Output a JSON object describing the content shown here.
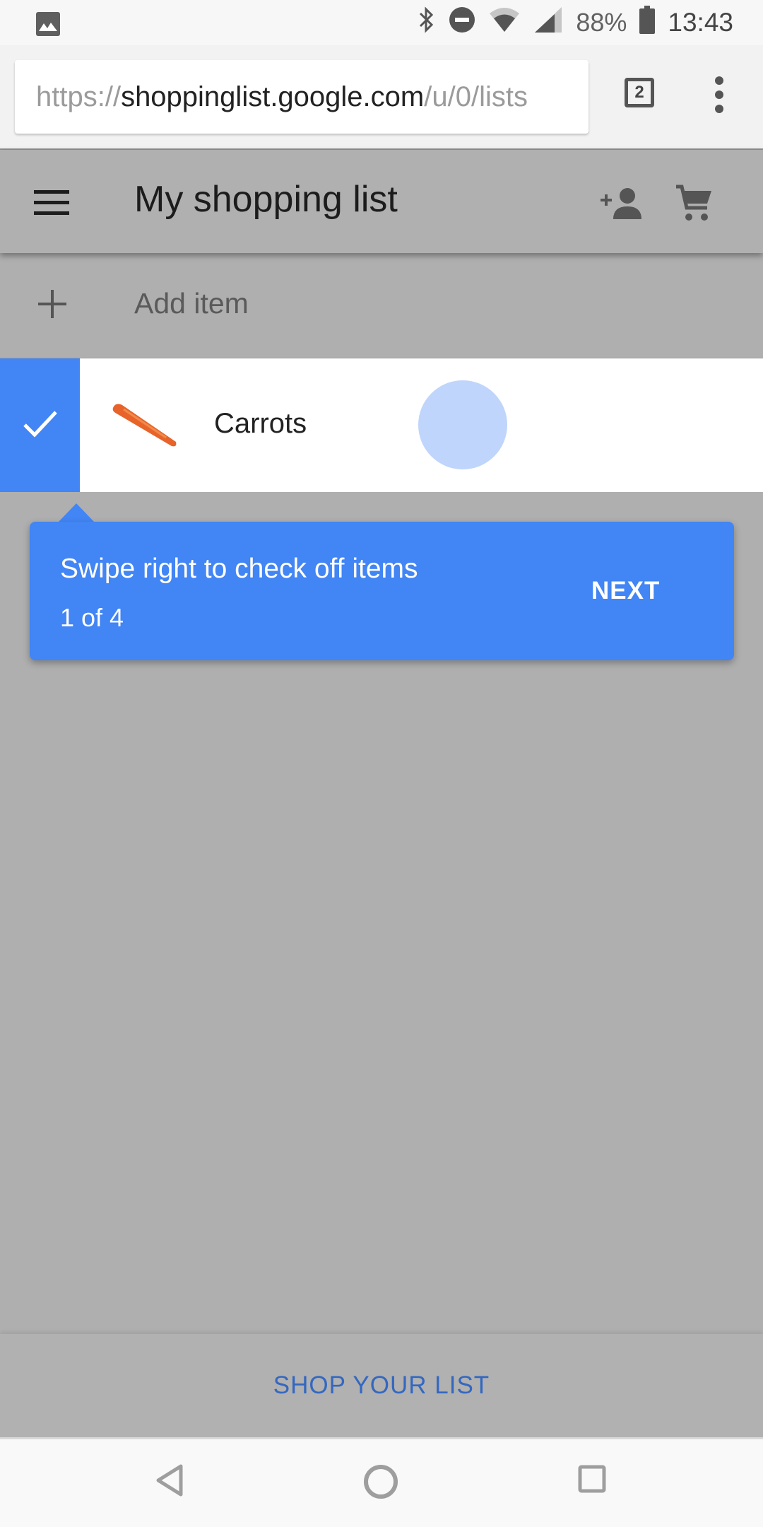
{
  "status_bar": {
    "left_icon": "image-icon",
    "icons": [
      "bluetooth-icon",
      "do-not-disturb-icon",
      "wifi-icon",
      "cell-signal-icon"
    ],
    "battery_percent": "88%",
    "battery_icon": "battery-icon",
    "time": "13:43"
  },
  "browser": {
    "url_scheme": "https://",
    "url_host": "shoppinglist.google.com",
    "url_path": "/u/0/lists",
    "tab_count": "2",
    "menu_icon": "more-vert-icon"
  },
  "app_bar": {
    "menu_icon": "hamburger-icon",
    "title": "My shopping list",
    "share_icon": "add-person-icon",
    "cart_icon": "shopping-cart-icon"
  },
  "add_item": {
    "icon": "plus-icon",
    "label": "Add item"
  },
  "items": [
    {
      "name": "Carrots",
      "image": "carrot-image",
      "check_icon": "check-icon",
      "check_color": "#4285f4"
    }
  ],
  "tooltip": {
    "title": "Swipe right to check off items",
    "progress": "1 of 4",
    "next_label": "NEXT",
    "color": "#4285f4"
  },
  "bottom_action": {
    "label": "SHOP YOUR LIST",
    "color": "#3468c0"
  },
  "nav_bar": {
    "back_icon": "back-triangle-icon",
    "home_icon": "home-circle-icon",
    "recents_icon": "recents-square-icon"
  }
}
